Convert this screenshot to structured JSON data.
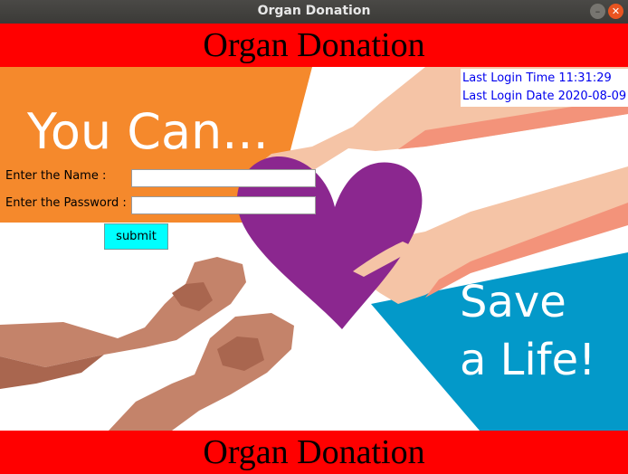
{
  "window": {
    "title": "Organ Donation"
  },
  "banner": {
    "top_text": "Organ Donation",
    "bottom_text": "Organ Donation"
  },
  "poster": {
    "line_1": "You Can...",
    "line_2": "Save",
    "line_3": "a Life!"
  },
  "login_info": {
    "time_label": "Last Login Time 11:31:29",
    "date_label": "Last Login Date 2020-08-09"
  },
  "form": {
    "name_label": "Enter the Name :",
    "password_label": "Enter the Password :",
    "name_value": "",
    "password_value": "",
    "submit_label": "submit"
  },
  "colors": {
    "banner": "#ff0000",
    "orange": "#f5892c",
    "blue": "#0399c9",
    "heart": "#8b278f",
    "submit": "#00ffff",
    "link": "#0000ee"
  }
}
